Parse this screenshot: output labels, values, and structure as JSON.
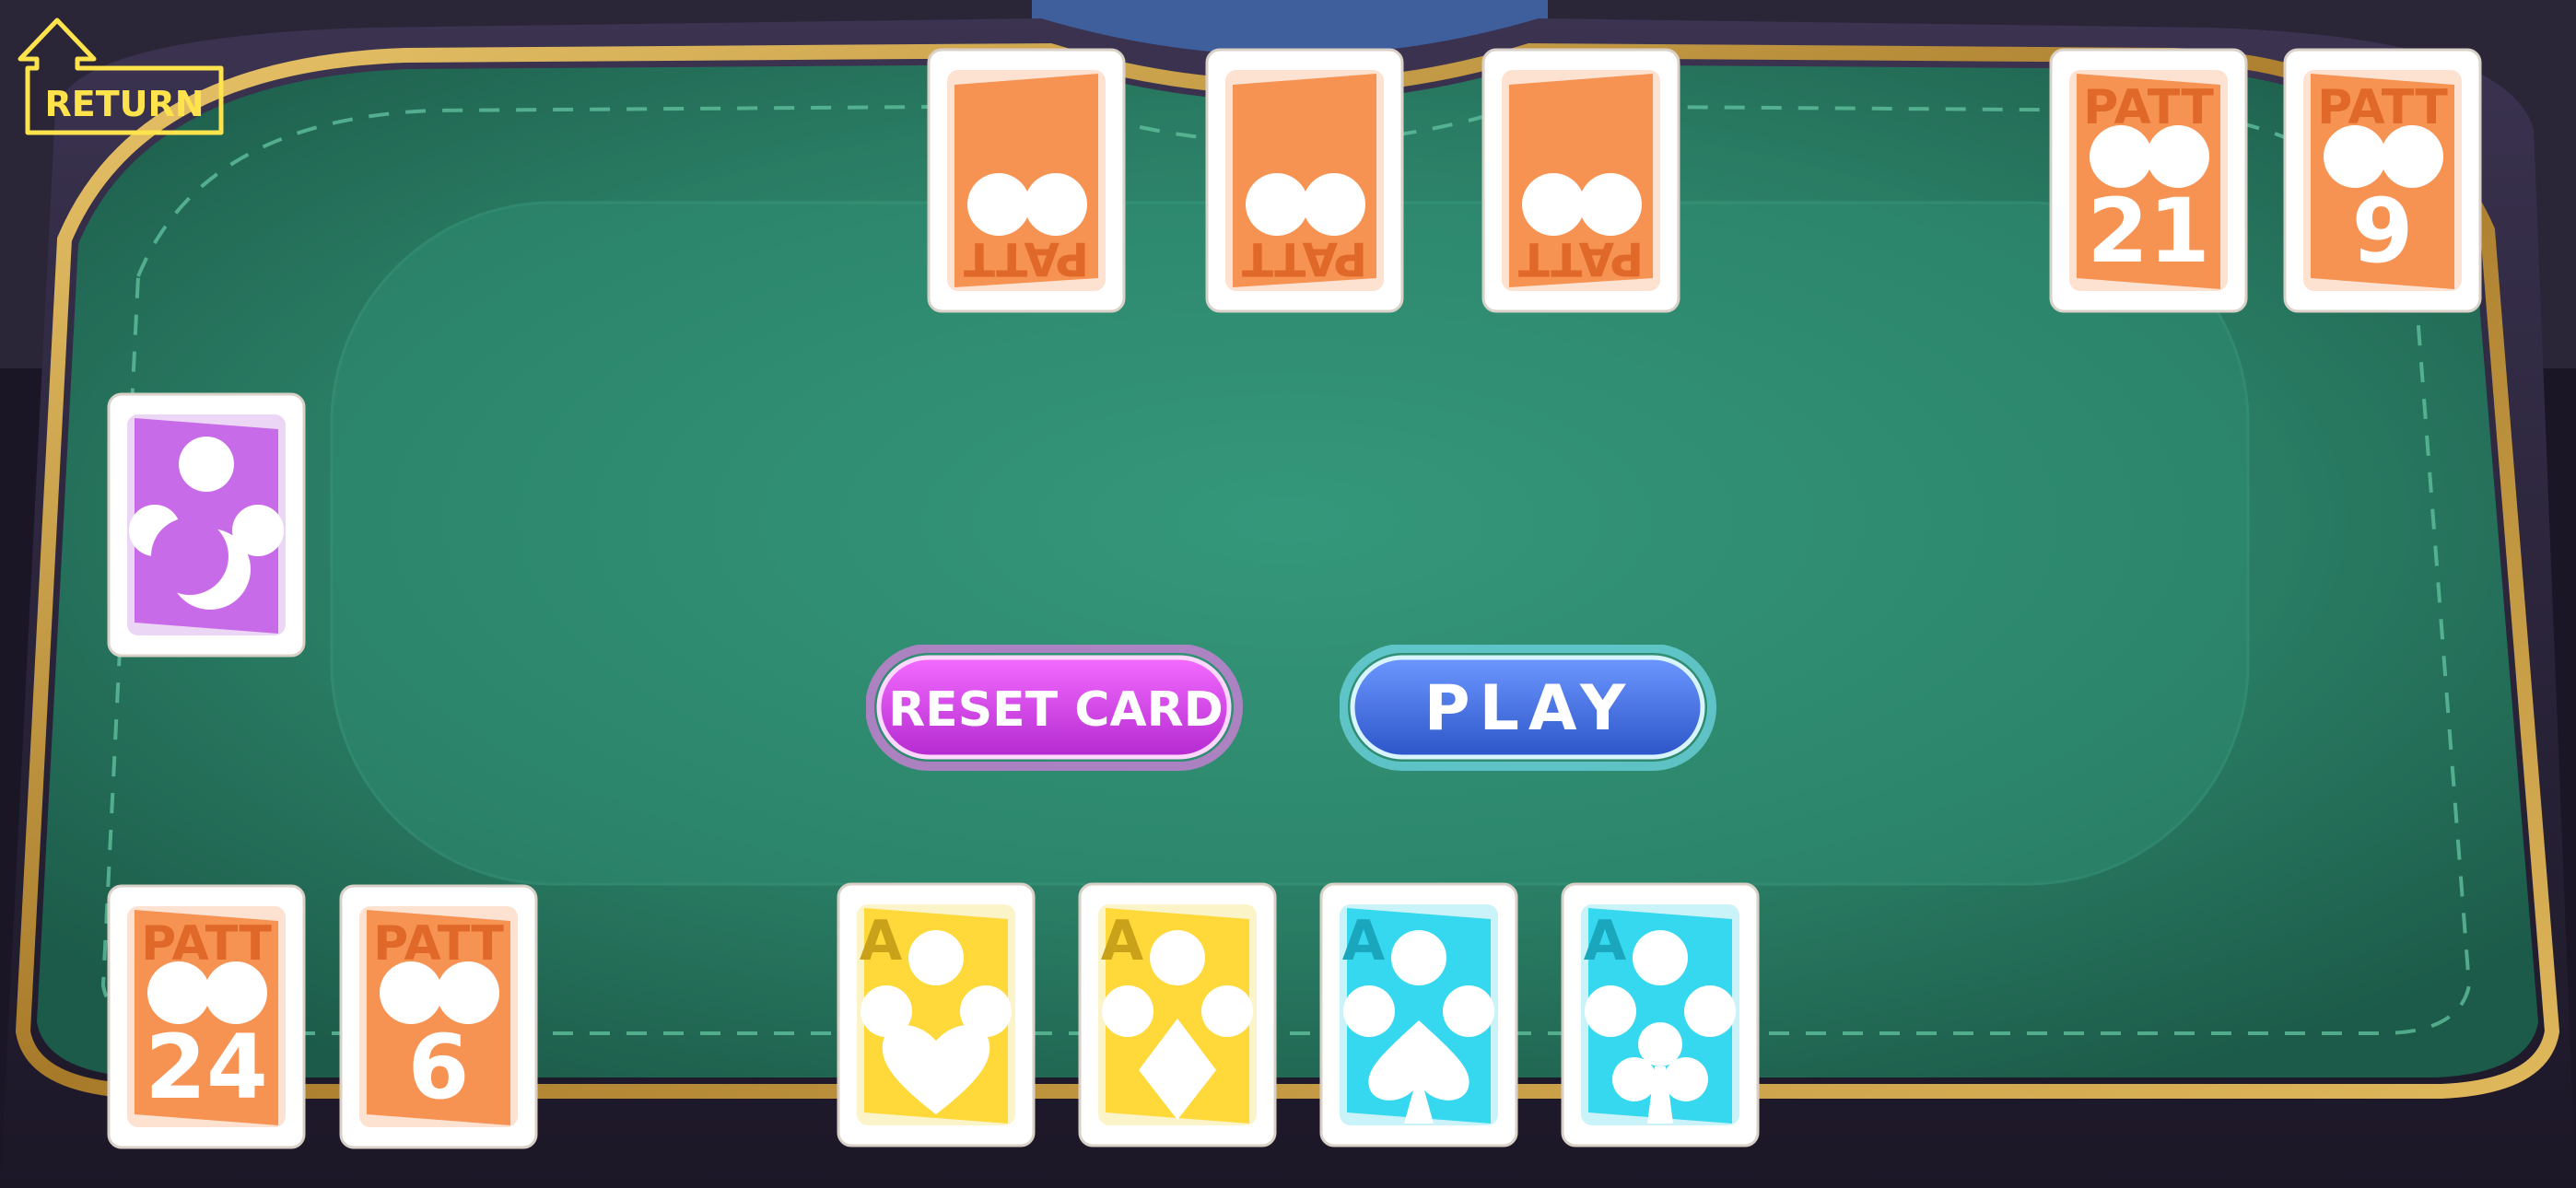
{
  "return_button": {
    "label": "RETURN",
    "color": "#ffe34d"
  },
  "buttons": {
    "reset": {
      "label": "RESET CARD",
      "color": "#e043f0"
    },
    "play": {
      "label": "PLAY",
      "color": "#3f74e6"
    }
  },
  "table": {
    "felt_color": "#2e8c70",
    "rail_color": "#2a2438",
    "trim_color": "#c9a24a"
  },
  "top_center_cards": [
    {
      "brand": "PATT",
      "orientation": "upside-down",
      "color": "#f79352"
    },
    {
      "brand": "PATT",
      "orientation": "upside-down",
      "color": "#f79352"
    },
    {
      "brand": "PATT",
      "orientation": "upside-down",
      "color": "#f79352"
    }
  ],
  "top_right_cards": [
    {
      "brand": "PATT",
      "number": "21",
      "color": "#f79352"
    },
    {
      "brand": "PATT",
      "number": "9",
      "color": "#f79352"
    }
  ],
  "left_card": {
    "color": "#c86be8",
    "icon": "moon-icon"
  },
  "bottom_left_cards": [
    {
      "brand": "PATT",
      "number": "24",
      "color": "#f79352"
    },
    {
      "brand": "PATT",
      "number": "6",
      "color": "#f79352"
    }
  ],
  "hand_cards": [
    {
      "rank": "A",
      "suit": "heart",
      "color": "#ffd83a",
      "text_color": "#c9a21a"
    },
    {
      "rank": "A",
      "suit": "diamond",
      "color": "#ffd83a",
      "text_color": "#c9a21a"
    },
    {
      "rank": "A",
      "suit": "spade",
      "color": "#35d8ee",
      "text_color": "#1aa6bd"
    },
    {
      "rank": "A",
      "suit": "club",
      "color": "#35d8ee",
      "text_color": "#1aa6bd"
    }
  ]
}
